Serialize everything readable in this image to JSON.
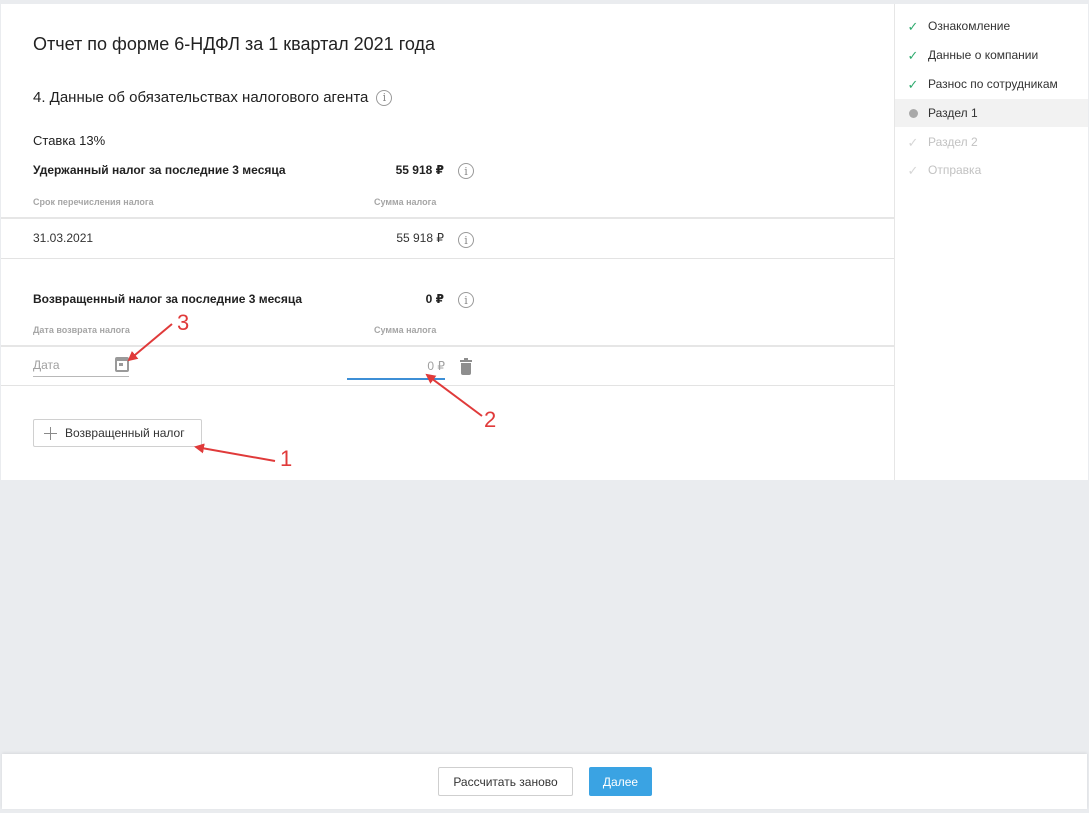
{
  "page": {
    "title": "Отчет по форме 6-НДФЛ за 1 квартал 2021 года",
    "section_title": "4. Данные об обязательствах налогового агента",
    "rate_label": "Ставка 13%"
  },
  "withheld": {
    "label": "Удержанный налог за последние 3 месяца",
    "sum": "55 918 ₽",
    "col_date_header": "Срок перечисления налога",
    "col_sum_header": "Сумма налога",
    "rows": [
      {
        "date": "31.03.2021",
        "sum": "55 918 ₽"
      }
    ]
  },
  "returned": {
    "label": "Возвращенный налог за последние 3 месяца",
    "sum": "0 ₽",
    "col_date_header": "Дата возврата налога",
    "col_sum_header": "Сумма налога",
    "date_placeholder": "Дата",
    "sum_value": "0 ₽",
    "add_button_label": "Возвращенный налог"
  },
  "steps": [
    {
      "label": "Ознакомление",
      "state": "done"
    },
    {
      "label": "Данные о компании",
      "state": "done"
    },
    {
      "label": "Разнос по сотрудникам",
      "state": "done"
    },
    {
      "label": "Раздел 1",
      "state": "active"
    },
    {
      "label": "Раздел 2",
      "state": "pending"
    },
    {
      "label": "Отправка",
      "state": "pending"
    }
  ],
  "footer": {
    "recalculate_label": "Рассчитать заново",
    "next_label": "Далее"
  },
  "annotations": {
    "n1": "1",
    "n2": "2",
    "n3": "3"
  },
  "colors": {
    "accent": "#3aa3e3",
    "check": "#2eaa6e",
    "annotation": "#e03a3a",
    "input_focus": "#3d8fd6"
  },
  "icons": {
    "info": "info-circle-icon",
    "calendar": "calendar-icon",
    "trash": "trash-icon",
    "plus": "plus-icon",
    "check": "check-icon",
    "dot": "dot-icon"
  }
}
